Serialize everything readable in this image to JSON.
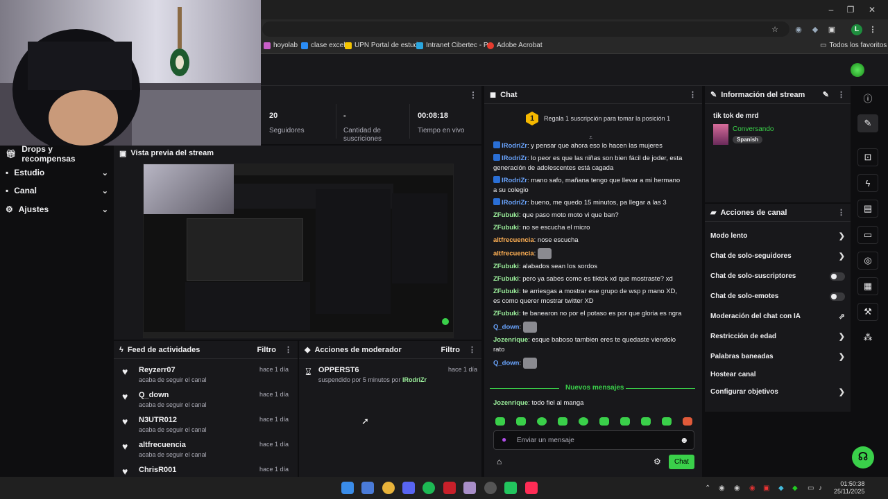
{
  "browser": {
    "window_controls": [
      "–",
      "❐",
      "✕"
    ],
    "bookmarks": [
      {
        "label": "hoyolab",
        "color": "#c85ec8"
      },
      {
        "label": "clase excel",
        "color": "#2a8cf5"
      },
      {
        "label": "UPN Portal de estud...",
        "color": "#f5c400"
      },
      {
        "label": "Intranet Cibertec - P...",
        "color": "#2aa6df"
      },
      {
        "label": "Adobe Acrobat",
        "color": "#e63b2e"
      }
    ],
    "favorites_label": "Todos los favoritos",
    "profile_initial": "L"
  },
  "stats": [
    {
      "value": "20",
      "label": "Seguidores"
    },
    {
      "value": "-",
      "label": "Cantidad de suscriciones"
    },
    {
      "value": "00:08:18",
      "label": "Tiempo en vivo"
    }
  ],
  "sidebar": {
    "items": [
      {
        "label": "Drops y recompensas",
        "chevron": false
      },
      {
        "label": "Estudio",
        "chevron": true
      },
      {
        "label": "Canal",
        "chevron": true
      },
      {
        "label": "Ajustes",
        "chevron": true
      }
    ]
  },
  "preview": {
    "title": "Vista previa del stream"
  },
  "feed": {
    "title": "Feed de actividades",
    "filter": "Filtro",
    "items": [
      {
        "name": "Reyzerr07",
        "sub": "acaba de seguir el canal",
        "time": "hace 1 día"
      },
      {
        "name": "Q_down",
        "sub": "acaba de seguir el canal",
        "time": "hace 1 día"
      },
      {
        "name": "N3UTR012",
        "sub": "acaba de seguir el canal",
        "time": "hace 1 día"
      },
      {
        "name": "altfrecuencia",
        "sub": "acaba de seguir el canal",
        "time": "hace 1 día"
      },
      {
        "name": "ChrisR001",
        "sub": "",
        "time": "hace 1 día"
      }
    ]
  },
  "mod": {
    "title": "Acciones de moderador",
    "filter": "Filtro",
    "item": {
      "name": "OPPERST6",
      "sub_prefix": "suspendido por 5 minutos por",
      "sub_user": "lRodriZr",
      "time": "hace 1 día"
    }
  },
  "chat": {
    "title": "Chat",
    "banner": "Regala 1 suscripción para tomar la posición 1",
    "banner_rank": "1",
    "messages": [
      {
        "user": "lRodriZr",
        "color": "blue",
        "badge": true,
        "text": "y pensar que ahora eso lo hacen las mujeres"
      },
      {
        "user": "lRodriZr",
        "color": "blue",
        "badge": true,
        "text": "lo peor es que las niñas son bien fácil de joder, esta generación de adolescentes está cagada"
      },
      {
        "user": "lRodriZr",
        "color": "blue",
        "badge": true,
        "text": "mano safo, mañana tengo que llevar a mi hermano a su colegio"
      },
      {
        "user": "lRodriZr",
        "color": "blue",
        "badge": true,
        "text": "bueno, me quedo 15 minutos, pa llegar a las 3"
      },
      {
        "user": "ZFubuki",
        "color": "green",
        "badge": false,
        "text": "que paso moto moto vi que ban?"
      },
      {
        "user": "ZFubuki",
        "color": "green",
        "badge": false,
        "text": "no se escucha el micro"
      },
      {
        "user": "altfrecuencia",
        "color": "orange",
        "badge": false,
        "text": "nose escucha"
      },
      {
        "user": "altfrecuencia",
        "color": "orange",
        "badge": false,
        "text": "",
        "emote": true
      },
      {
        "user": "ZFubuki",
        "color": "green",
        "badge": false,
        "text": "alabados sean los sordos"
      },
      {
        "user": "ZFubuki",
        "color": "green",
        "badge": false,
        "text": "pero ya sabes como es tiktok xd que mostraste? xd"
      },
      {
        "user": "ZFubuki",
        "color": "green",
        "badge": false,
        "text": "te arriesgas a mostrar ese grupo de wsp p mano XD, es como querer mostrar twitter XD"
      },
      {
        "user": "ZFubuki",
        "color": "green",
        "badge": false,
        "text": "te banearon no por el potaso es por que gloria es ngra"
      },
      {
        "user": "Q_down",
        "color": "blue",
        "badge": false,
        "text": "",
        "emote": true
      },
      {
        "user": "Jozenrique",
        "color": "green",
        "badge": false,
        "text": "esque baboso tambien eres te quedaste viendolo rato"
      },
      {
        "user": "Q_down",
        "color": "blue",
        "badge": false,
        "text": "",
        "emote": true
      }
    ],
    "new_messages_label": "Nuevos mensajes",
    "last_message": {
      "user": "Jozenrique",
      "text": "todo fiel al manga"
    },
    "input_placeholder": "Enviar un mensaje",
    "send_label": "Chat"
  },
  "stream_info": {
    "title": "Información del stream",
    "stream_title": "tik tok de mrd",
    "category": "Conversando",
    "language": "Spanish"
  },
  "channel_actions": {
    "title": "Acciones de canal",
    "items": [
      {
        "label": "Modo lento",
        "control": "chevron"
      },
      {
        "label": "Chat de solo-seguidores",
        "control": "chevron"
      },
      {
        "label": "Chat de solo-suscriptores",
        "control": "toggle"
      },
      {
        "label": "Chat de solo-emotes",
        "control": "toggle"
      },
      {
        "label": "Moderación del chat con IA",
        "control": "external"
      },
      {
        "label": "Restricción de edad",
        "control": "chevron"
      },
      {
        "label": "Palabras baneadas",
        "control": "chevron"
      },
      {
        "label": "Hostear canal",
        "control": "none"
      },
      {
        "label": "Configurar objetivos",
        "control": "chevron"
      }
    ]
  },
  "taskbar": {
    "time": "01:50:38",
    "date": "25/11/2025"
  }
}
